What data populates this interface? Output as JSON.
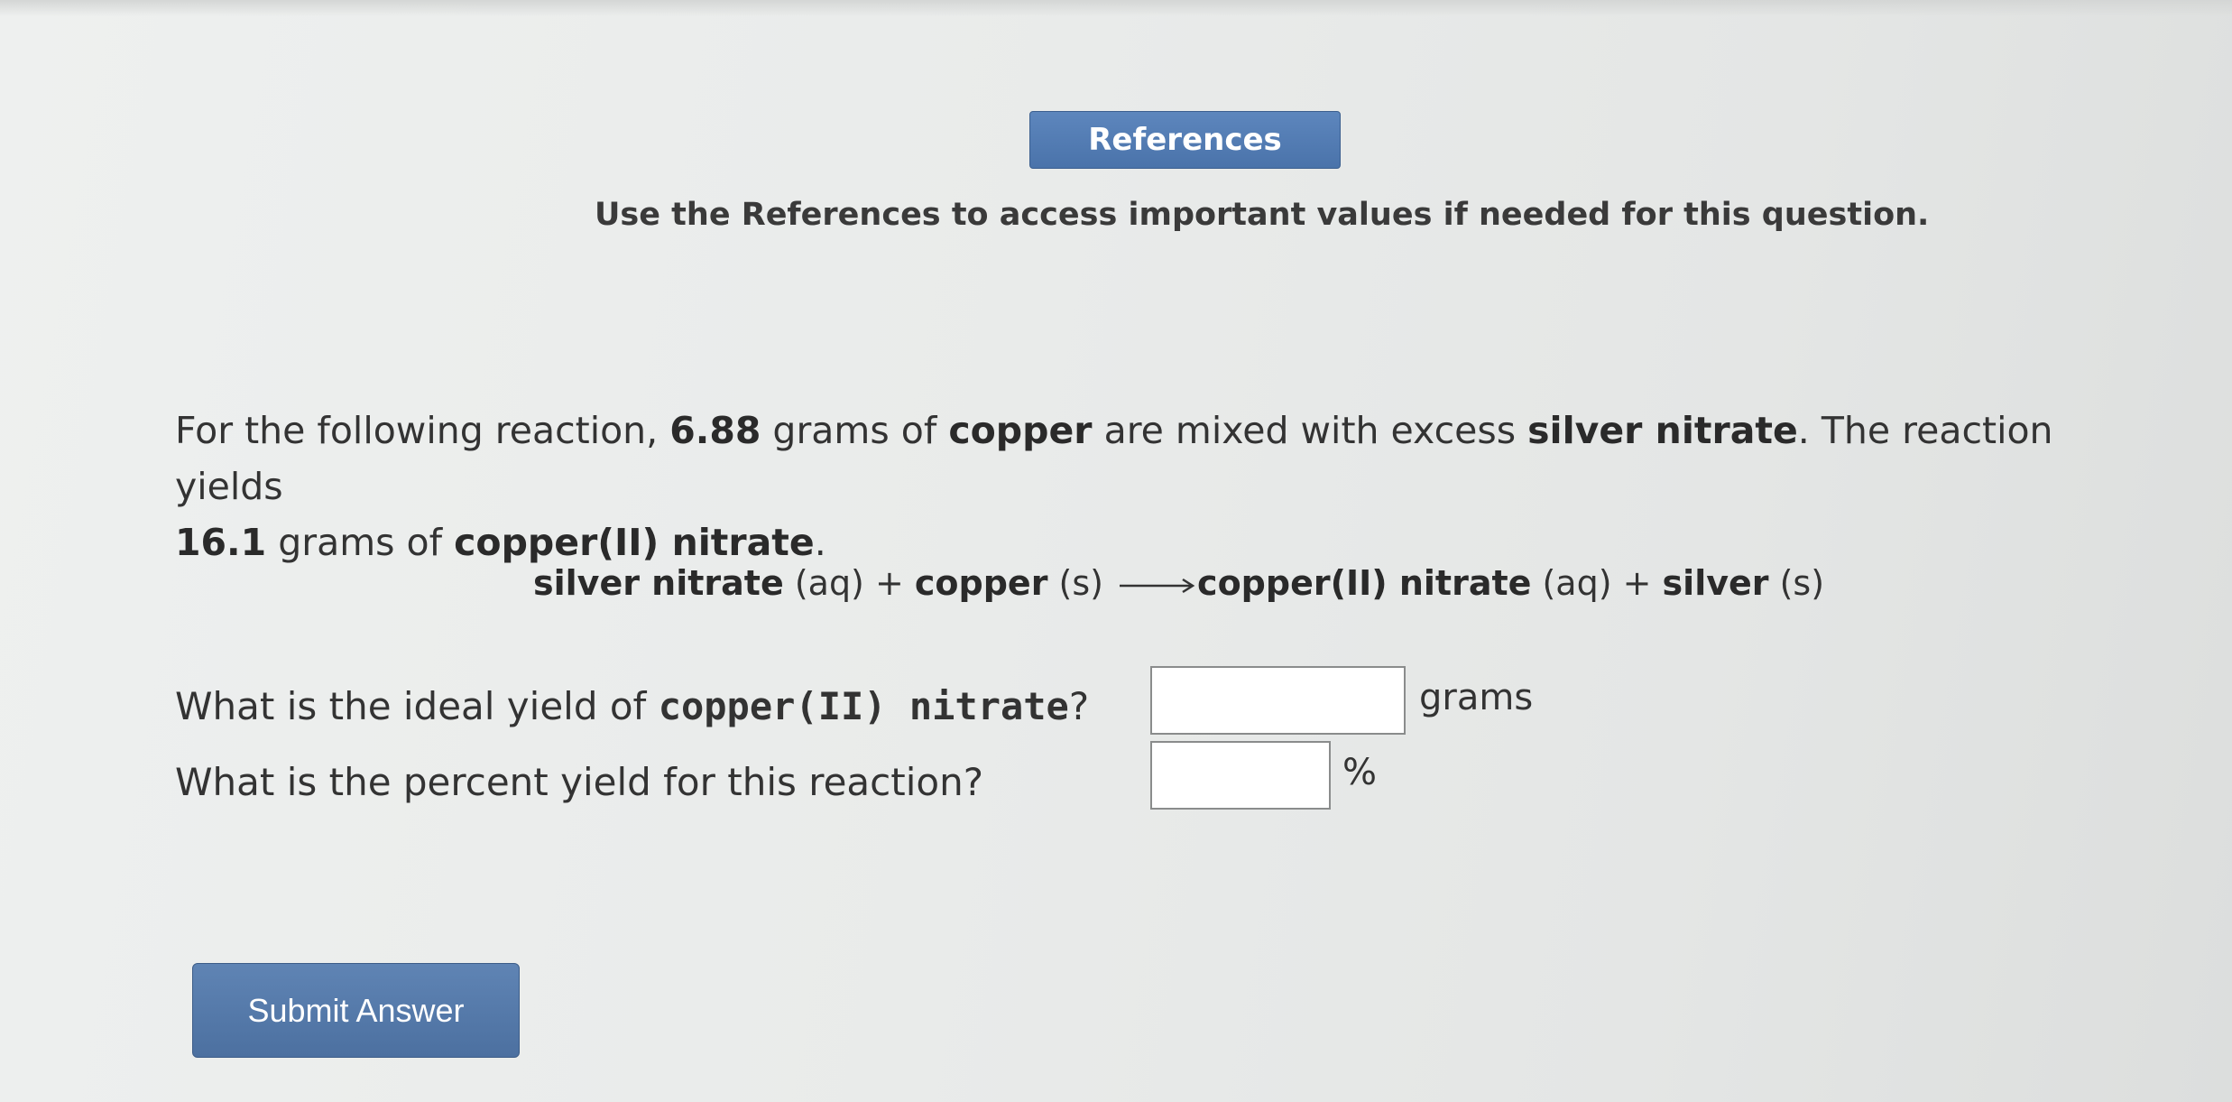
{
  "references": {
    "button_label": "References",
    "note": "Use the References to access important values if needed for this question."
  },
  "problem": {
    "p1": "For the following reaction, ",
    "mass_copper": "6.88",
    "p2": " grams of ",
    "reactant1": "copper",
    "p3": " are mixed with excess ",
    "reactant2": "silver nitrate",
    "p4": ". The reaction yields ",
    "mass_product": "16.1",
    "p5": " grams of ",
    "product": "copper(II) nitrate",
    "p6": "."
  },
  "equation": {
    "reactant_a": "silver nitrate",
    "state_a": " (aq) + ",
    "reactant_b": "copper",
    "state_b": " (s) ",
    "product_a": "copper(II) nitrate",
    "state_pa": " (aq) + ",
    "product_b": "silver",
    "state_pb": " (s)"
  },
  "questions": {
    "q1_prefix": "What is the ideal yield of ",
    "q1_bold": "copper(II) nitrate",
    "q1_suffix": "?",
    "q1_unit": "grams",
    "q1_value": "",
    "q2_text": "What is the percent yield for this reaction?",
    "q2_unit": "%",
    "q2_value": ""
  },
  "submit": {
    "label": "Submit Answer"
  },
  "colors": {
    "button_blue": "#4f77ad",
    "background": "#e9ebea"
  }
}
